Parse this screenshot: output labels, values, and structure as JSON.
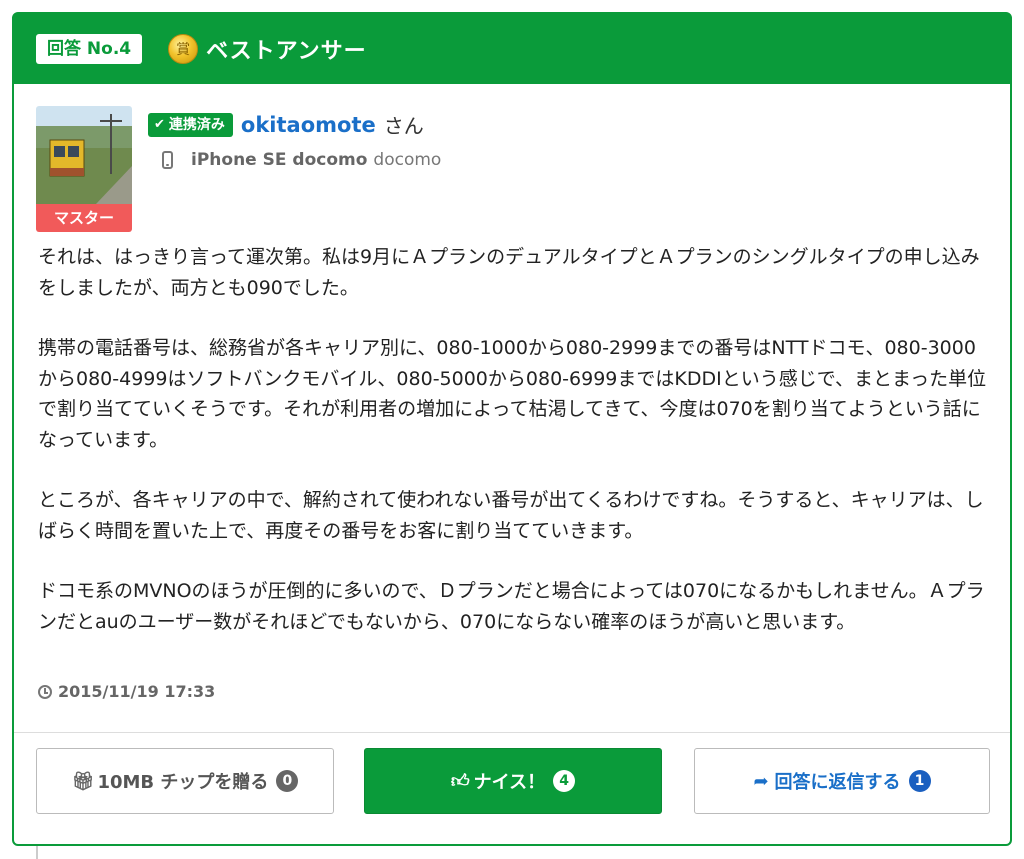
{
  "header": {
    "answer_no": "回答 No.4",
    "medal_glyph": "賞",
    "best_label": "ベストアンサー"
  },
  "user": {
    "master_tag": "マスター",
    "linked_badge": "連携済み",
    "name": "okitaomote",
    "suffix": "さん",
    "device": "iPhone SE docomo",
    "carrier": "docomo"
  },
  "answer": {
    "paragraphs": [
      "それは、はっきり言って運次第。私は9月にＡプランのデュアルタイプとＡプランのシングルタイプの申し込みをしましたが、両方とも090でした。",
      "携帯の電話番号は、総務省が各キャリア別に、080-1000から080-2999までの番号はNTTドコモ、080-3000から080-4999はソフトバンクモバイル、080-5000から080-6999まではKDDIという感じで、まとまった単位で割り当てていくそうです。それが利用者の増加によって枯渇してきて、今度は070を割り当てようという話になっています。",
      "ところが、各キャリアの中で、解約されて使われない番号が出てくるわけですね。そうすると、キャリアは、しばらく時間を置いた上で、再度その番号をお客に割り当てていきます。",
      "ドコモ系のMVNOのほうが圧倒的に多いので、Ｄプランだと場合によっては070になるかもしれません。Ａプランだとauのユーザー数がそれほどでもないから、070にならない確率のほうが高いと思います。"
    ],
    "timestamp": "2015/11/19 17:33"
  },
  "actions": {
    "gift_label": "10MB チップを贈る",
    "gift_count": "0",
    "nice_label": "ナイス！",
    "nice_count": "4",
    "reply_label": "回答に返信する",
    "reply_count": "1"
  },
  "colors": {
    "brand_green": "#0a9b3a",
    "link_blue": "#1a6fc8",
    "master_red": "#f15a5a"
  }
}
